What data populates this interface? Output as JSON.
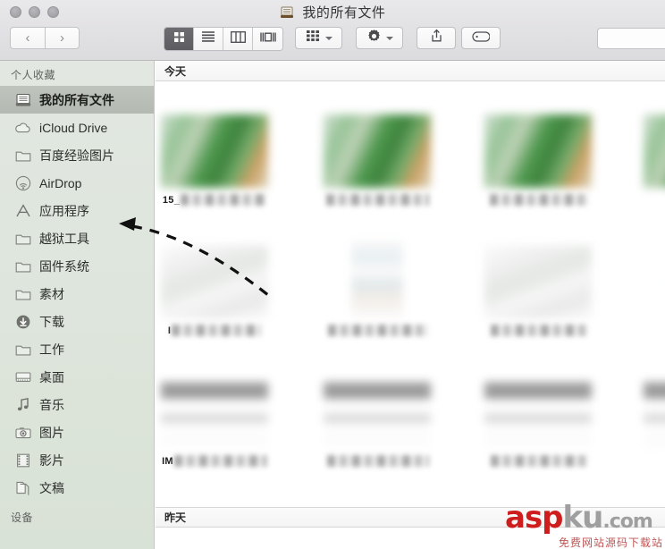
{
  "window": {
    "title": "我的所有文件",
    "title_icon": "all-my-files-icon",
    "traffic_lights": [
      "close",
      "minimize",
      "zoom"
    ]
  },
  "toolbar": {
    "back_label": "‹",
    "forward_label": "›",
    "view_modes": [
      {
        "name": "icon-view",
        "label": "图标显示",
        "active": true
      },
      {
        "name": "list-view",
        "label": "列表显示",
        "active": false
      },
      {
        "name": "column-view",
        "label": "分栏显示",
        "active": false
      },
      {
        "name": "coverflow-view",
        "label": "Cover Flow",
        "active": false
      }
    ],
    "arrange_label": "排列方式",
    "action_label": "操作",
    "share_label": "共享",
    "tag_label": "标记",
    "search_placeholder": ""
  },
  "sidebar": {
    "header": "个人收藏",
    "footer_header": "设备",
    "items": [
      {
        "label": "我的所有文件",
        "icon": "all-my-files-icon",
        "selected": true
      },
      {
        "label": "iCloud Drive",
        "icon": "cloud-icon",
        "selected": false
      },
      {
        "label": "百度经验图片",
        "icon": "folder-icon",
        "selected": false
      },
      {
        "label": "AirDrop",
        "icon": "airdrop-icon",
        "selected": false
      },
      {
        "label": "应用程序",
        "icon": "applications-icon",
        "selected": false
      },
      {
        "label": "越狱工具",
        "icon": "folder-icon",
        "selected": false
      },
      {
        "label": "固件系统",
        "icon": "folder-icon",
        "selected": false
      },
      {
        "label": "素材",
        "icon": "folder-icon",
        "selected": false
      },
      {
        "label": "下载",
        "icon": "downloads-icon",
        "selected": false
      },
      {
        "label": "工作",
        "icon": "folder-icon",
        "selected": false
      },
      {
        "label": "桌面",
        "icon": "desktop-icon",
        "selected": false
      },
      {
        "label": "音乐",
        "icon": "music-note-icon",
        "selected": false
      },
      {
        "label": "图片",
        "icon": "camera-icon",
        "selected": false
      },
      {
        "label": "影片",
        "icon": "film-icon",
        "selected": false
      },
      {
        "label": "文稿",
        "icon": "documents-icon",
        "selected": false
      }
    ]
  },
  "content": {
    "groups": [
      {
        "label": "今天"
      },
      {
        "label": "昨天"
      }
    ],
    "files": [
      {
        "name_visible": "15_",
        "blurred": true,
        "thumb": "green",
        "row": 0,
        "col": 0
      },
      {
        "name_visible": "",
        "blurred": true,
        "thumb": "green",
        "row": 0,
        "col": 1
      },
      {
        "name_visible": "",
        "blurred": true,
        "thumb": "green",
        "row": 0,
        "col": 2
      },
      {
        "name_visible": "",
        "blurred": true,
        "thumb": "green",
        "row": 0,
        "col": 3
      },
      {
        "name_visible": "I",
        "blurred": true,
        "thumb": "pale",
        "row": 1,
        "col": 0
      },
      {
        "name_visible": "",
        "blurred": true,
        "thumb": "tall",
        "row": 1,
        "col": 1
      },
      {
        "name_visible": "",
        "blurred": true,
        "thumb": "pale",
        "row": 1,
        "col": 2
      },
      {
        "name_visible": "",
        "blurred": true,
        "thumb": "tall",
        "row": 1,
        "col": 3
      },
      {
        "name_visible": "IM",
        "blurred": true,
        "thumb": "doc",
        "row": 2,
        "col": 0
      },
      {
        "name_visible": "",
        "blurred": true,
        "thumb": "doc",
        "row": 2,
        "col": 1
      },
      {
        "name_visible": "",
        "blurred": true,
        "thumb": "doc",
        "row": 2,
        "col": 2
      },
      {
        "name_visible": "",
        "blurred": true,
        "thumb": "doc",
        "row": 2,
        "col": 3
      }
    ]
  },
  "annotation": {
    "arrow_name": "dashed-pointer-arrow",
    "points_to": "应用程序"
  },
  "watermark": {
    "brand_a": "asp",
    "brand_b": "ku",
    "brand_c": ".com",
    "subtitle": "免费网站源码下载站"
  },
  "colors": {
    "accent_red": "#cf1c1c",
    "sidebar_bg": "#dfe6de",
    "selection": "#b9beb7",
    "titlebar": "#e2e1e4"
  }
}
